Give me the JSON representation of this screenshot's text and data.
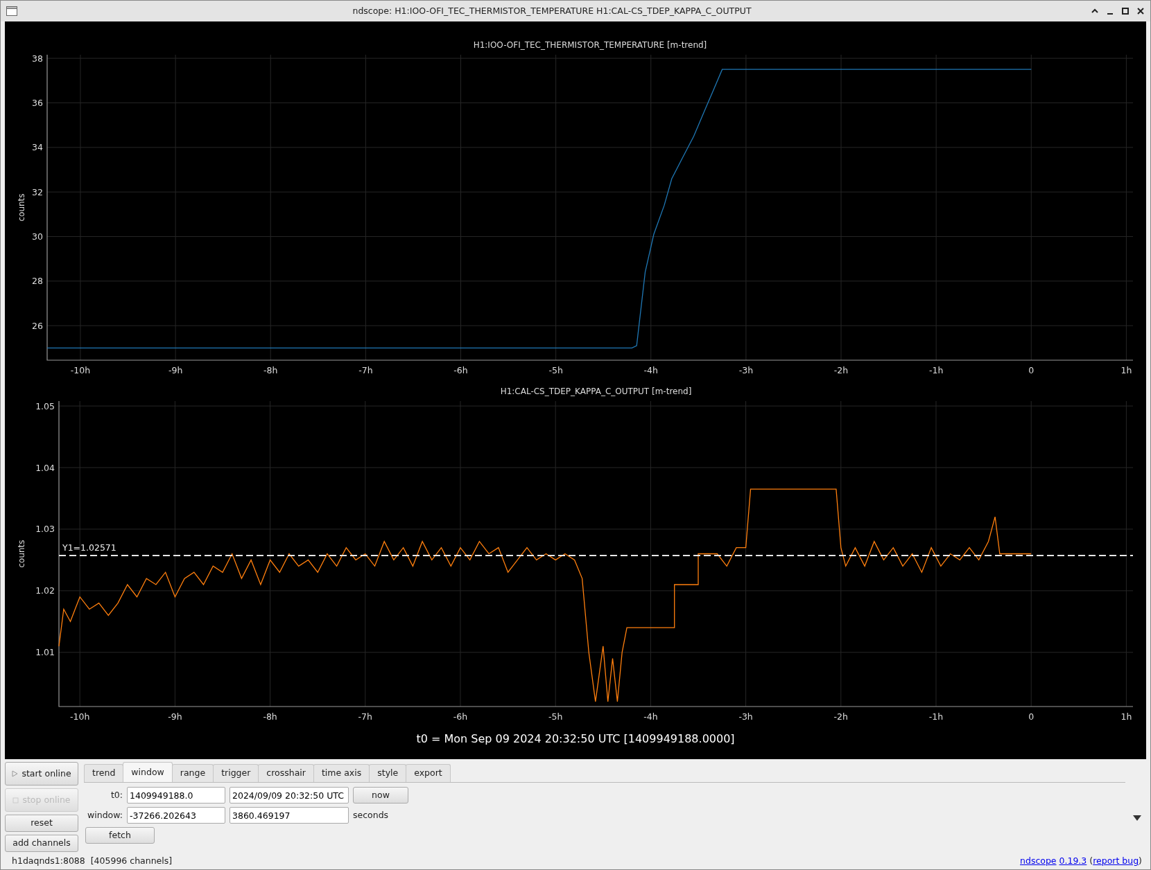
{
  "window": {
    "title": "ndscope: H1:IOO-OFI_TEC_THERMISTOR_TEMPERATURE H1:CAL-CS_TDEP_KAPPA_C_OUTPUT"
  },
  "plots": [
    {
      "chart_data": {
        "type": "line",
        "title": "H1:IOO-OFI_TEC_THERMISTOR_TEMPERATURE [m-trend]",
        "ylabel": "counts",
        "x": [
          -10.35,
          -4.2,
          -4.15,
          -4.06,
          -3.97,
          -3.86,
          -3.78,
          -3.66,
          -3.55,
          -3.43,
          -3.35,
          -3.25,
          0
        ],
        "series": [
          {
            "color": "#1f77b4",
            "values": [
              25.0,
              25.0,
              25.1,
              28.4,
              30.1,
              31.4,
              32.6,
              33.6,
              34.5,
              35.7,
              36.5,
              37.5,
              37.5
            ]
          }
        ],
        "xlim": [
          -10.35,
          1.07
        ],
        "ylim": [
          24.45,
          38.16
        ],
        "grid": true,
        "xticks": [
          {
            "value": -10,
            "label": "-10h"
          },
          {
            "value": -9,
            "label": "-9h"
          },
          {
            "value": -8,
            "label": "-8h"
          },
          {
            "value": -7,
            "label": "-7h"
          },
          {
            "value": -6,
            "label": "-6h"
          },
          {
            "value": -5,
            "label": "-5h"
          },
          {
            "value": -4,
            "label": "-4h"
          },
          {
            "value": -3,
            "label": "-3h"
          },
          {
            "value": -2,
            "label": "-2h"
          },
          {
            "value": -1,
            "label": "-1h"
          },
          {
            "value": 0,
            "label": "0"
          },
          {
            "value": 1,
            "label": "1h"
          }
        ],
        "yticks": [
          26,
          28,
          30,
          32,
          34,
          36,
          38
        ]
      }
    },
    {
      "chart_data": {
        "type": "line",
        "title": "H1:CAL-CS_TDEP_KAPPA_C_OUTPUT [m-trend]",
        "ylabel": "counts",
        "x": [
          -10.22,
          -10.17,
          -10.1,
          -10.05,
          -10.0,
          -9.9,
          -9.8,
          -9.7,
          -9.6,
          -9.5,
          -9.4,
          -9.3,
          -9.2,
          -9.1,
          -9.0,
          -8.9,
          -8.8,
          -8.7,
          -8.6,
          -8.5,
          -8.4,
          -8.3,
          -8.2,
          -8.1,
          -8.0,
          -7.9,
          -7.8,
          -7.7,
          -7.6,
          -7.5,
          -7.4,
          -7.3,
          -7.2,
          -7.1,
          -7.0,
          -6.9,
          -6.8,
          -6.7,
          -6.6,
          -6.5,
          -6.4,
          -6.3,
          -6.2,
          -6.1,
          -6.0,
          -5.9,
          -5.8,
          -5.7,
          -5.6,
          -5.5,
          -5.4,
          -5.3,
          -5.2,
          -5.1,
          -5.0,
          -4.9,
          -4.8,
          -4.72,
          -4.65,
          -4.58,
          -4.5,
          -4.45,
          -4.4,
          -4.35,
          -4.3,
          -4.25,
          -3.75,
          -3.75,
          -3.5,
          -3.5,
          -3.3,
          -3.2,
          -3.1,
          -3.0,
          -2.95,
          -2.05,
          -2.0,
          -1.95,
          -1.85,
          -1.75,
          -1.65,
          -1.55,
          -1.45,
          -1.35,
          -1.25,
          -1.15,
          -1.05,
          -0.95,
          -0.85,
          -0.75,
          -0.65,
          -0.55,
          -0.45,
          -0.38,
          -0.33,
          0
        ],
        "series": [
          {
            "color": "#ff7f0e",
            "values": [
              1.011,
              1.017,
              1.015,
              1.017,
              1.019,
              1.017,
              1.018,
              1.016,
              1.018,
              1.021,
              1.019,
              1.022,
              1.021,
              1.023,
              1.019,
              1.022,
              1.023,
              1.021,
              1.024,
              1.023,
              1.026,
              1.022,
              1.025,
              1.021,
              1.025,
              1.023,
              1.026,
              1.024,
              1.025,
              1.023,
              1.026,
              1.024,
              1.027,
              1.025,
              1.026,
              1.024,
              1.028,
              1.025,
              1.027,
              1.024,
              1.028,
              1.025,
              1.027,
              1.024,
              1.027,
              1.025,
              1.028,
              1.026,
              1.027,
              1.023,
              1.025,
              1.027,
              1.025,
              1.026,
              1.025,
              1.026,
              1.025,
              1.022,
              1.01,
              1.002,
              1.011,
              1.002,
              1.009,
              1.002,
              1.01,
              1.014,
              1.014,
              1.021,
              1.021,
              1.026,
              1.026,
              1.024,
              1.027,
              1.027,
              1.0365,
              1.0365,
              1.027,
              1.024,
              1.027,
              1.024,
              1.028,
              1.025,
              1.027,
              1.024,
              1.026,
              1.023,
              1.027,
              1.024,
              1.026,
              1.025,
              1.027,
              1.025,
              1.028,
              1.032,
              1.026,
              1.026
            ]
          }
        ],
        "xlim": [
          -10.22,
          1.07
        ],
        "ylim": [
          1.0012,
          1.0508
        ],
        "grid": true,
        "xticks": [
          {
            "value": -10,
            "label": "-10h"
          },
          {
            "value": -9,
            "label": "-9h"
          },
          {
            "value": -8,
            "label": "-8h"
          },
          {
            "value": -7,
            "label": "-7h"
          },
          {
            "value": -6,
            "label": "-6h"
          },
          {
            "value": -5,
            "label": "-5h"
          },
          {
            "value": -4,
            "label": "-4h"
          },
          {
            "value": -3,
            "label": "-3h"
          },
          {
            "value": -2,
            "label": "-2h"
          },
          {
            "value": -1,
            "label": "-1h"
          },
          {
            "value": 0,
            "label": "0"
          },
          {
            "value": 1,
            "label": "1h"
          }
        ],
        "yticks": [
          1.01,
          1.02,
          1.03,
          1.04,
          1.05
        ],
        "ref_lines": [
          {
            "axis": "y",
            "value": 1.02571,
            "label": "Y1=1.02571"
          }
        ]
      }
    }
  ],
  "t0_label": "t0 = Mon Sep 09 2024 20:32:50 UTC [1409949188.0000]",
  "controls": {
    "buttons": [
      {
        "label": "start online",
        "kind": "play",
        "disabled": false
      },
      {
        "label": "stop online",
        "kind": "stop",
        "disabled": true
      },
      {
        "label": "reset",
        "kind": "plain",
        "disabled": false
      },
      {
        "label": "add channels",
        "kind": "plain",
        "disabled": false
      }
    ],
    "tabs": [
      {
        "label": "trend",
        "selected": false
      },
      {
        "label": "window",
        "selected": true
      },
      {
        "label": "range",
        "selected": false
      },
      {
        "label": "trigger",
        "selected": false
      },
      {
        "label": "crosshair",
        "selected": false
      },
      {
        "label": "time axis",
        "selected": false
      },
      {
        "label": "style",
        "selected": false
      },
      {
        "label": "export",
        "selected": false
      }
    ],
    "t0": {
      "label": "t0:",
      "gps": "1409949188.0",
      "utc": "2024/09/09 20:32:50 UTC",
      "button": "now"
    },
    "window": {
      "label": "window:",
      "start": "-37266.202643",
      "end": "3860.469197",
      "unit": "seconds"
    },
    "fetch": "fetch"
  },
  "status_bar": {
    "server": "h1daqnds1:8088  [405996 channels]",
    "parts": [
      {
        "kind": "link",
        "text": "ndscope"
      },
      {
        "kind": "link",
        "text": "0.19.3"
      },
      {
        "kind": "text",
        "text": " ("
      },
      {
        "kind": "link",
        "text": "report bug"
      },
      {
        "kind": "text",
        "text": ")"
      }
    ]
  }
}
